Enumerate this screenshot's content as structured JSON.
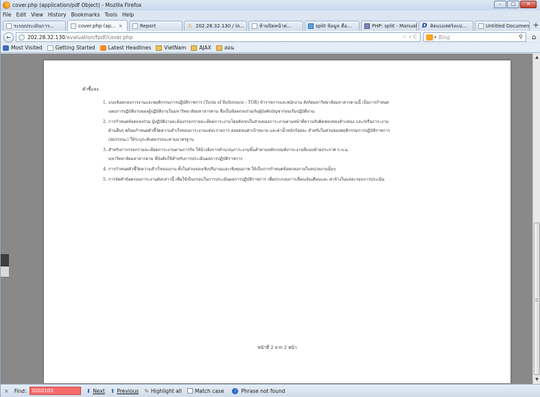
{
  "window": {
    "title": "cover.php (application/pdf Object) - Mozilla Firefox",
    "controls": {
      "minimize": "–",
      "maximize": "□",
      "close": "✕"
    }
  },
  "menu": [
    "File",
    "Edit",
    "View",
    "History",
    "Bookmarks",
    "Tools",
    "Help"
  ],
  "tabs": [
    {
      "label": "ระบบประเมินการ...",
      "icon": "page-icon",
      "active": false
    },
    {
      "label": "cover.php (ap...",
      "icon": "pdf-icon",
      "active": true,
      "close": "×"
    },
    {
      "label": "Report",
      "icon": "page-icon",
      "active": false
    },
    {
      "label": "202.28.32.130 / lo...",
      "icon": "warning-icon",
      "active": false
    },
    {
      "label": "ห้ามปิดหน้าต่...",
      "icon": "page-icon",
      "active": false
    },
    {
      "label": "split ข้อมูล คือ...",
      "icon": "twitter-icon",
      "active": false
    },
    {
      "label": "PHP: split - Manual",
      "icon": "php-icon",
      "active": false
    },
    {
      "label": "ดิดแบ่งสตริงแป...",
      "icon": "d-icon",
      "active": false
    },
    {
      "label": "Untitled Document",
      "icon": "page-icon",
      "active": false
    }
  ],
  "new_tab": "+",
  "nav": {
    "back": "←",
    "url_host": "202.28.32.130",
    "url_path": "/evaluation/fpdf/cover.php",
    "url_right": "☆ ▿ C",
    "search_placeholder": "Bing",
    "search_icon": "⚲",
    "home": "⌂"
  },
  "bookmarks": [
    {
      "label": "Most Visited",
      "icon": "firefox-icon"
    },
    {
      "label": "Getting Started",
      "icon": "page-icon"
    },
    {
      "label": "Latest Headlines",
      "icon": "rss-icon"
    },
    {
      "label": "VietNam",
      "icon": "folder-icon"
    },
    {
      "label": "AJAX",
      "icon": "folder-icon"
    },
    {
      "label": "สอน",
      "icon": "folder-icon"
    }
  ],
  "pdf": {
    "heading": "คำชี้แจง",
    "items": [
      {
        "num": "1.",
        "text": "แบบข้อตกลงการงานและพฤติกรรมการปฏิบัติราชการ (Term of Reference : TOR) ข้าราชการและพนักงาน สังกัดมหาวิทยาลัยมหาสารคามนี้ เป็นการกำหนด\nแผนการปฏิบัติงานของผู้ปฏิบัติงานในมหาวิทยาลัยมหาสารคาม ซึ่งเป็นข้อตกลงร่วมกันผู้บังคับบัญชาก่อนเริ่มปฏิบัติงาน"
      },
      {
        "num": "2.",
        "text": "การกำหนดข้อตกลงร่วม ผู้ปฏิบัติงานจะต้องกรอกรายละเอียดภาระงานโดยสังเขปในส่วนของภาระงานตามหน้าที่ความรับผิดชอบของตำแหน่ง และ/หรือภาระงาน\nด้านอื่นๆ พร้อมกำหนดตัวชี้วัดความสำเร็จของภาระงานแต่ละรายการ ตลอดจนค่าเป้าหมาย และค่าน้ำหนักร้อยละ สำหรับในส่วนของพฤติกรรมการปฏิบัติราชการ\n(สมรรถนะ) ให้ระบุระดับสมรรถนะตามมาตรฐาน"
      },
      {
        "num": "3.",
        "text": "สำหรับการกรอกรายละเอียดภาระงานตามภารกิจ ให้อ้างอิงการคำนวณภาระงานขั้นต่ำตามหลักเกณฑ์ภาระงานที่แนบท้ายประกาศ ก.บ.ม.\nมหาวิทยาลัยมหาสารคาม ที่บังคับใช้สำหรับการประเมินผลการปฏิบัติราชการ"
      },
      {
        "num": "4.",
        "text": "การกำหนดตัวชี้วัดความสำเร็จของงาน ทั้งในส่วนของเชิงปริมาณและเชิงคุณภาพ ให้เป็นการกำหนดข้อตกลงภายในหน่วยงานนั้นๆ"
      },
      {
        "num": "5.",
        "text": "การจัดทำข้อตกลงภาระงานดังกล่าวนี้ เพื่อใช้เป็นกรอบในการประเมินผลการปฏิบัติราชการ เพื่อประกอบการเลื่อนเงินเดือนและ ค่าจ้างในแต่ละรอบการประเมิน"
      }
    ],
    "footer": "หน้าที่ 2 จาก 2 หน้า"
  },
  "scroll": {
    "up": "▲",
    "down": "▼"
  },
  "findbar": {
    "close": "×",
    "label": "Find:",
    "value": "0202103",
    "next": "Next",
    "previous": "Previous",
    "highlight": "Highlight all",
    "match_case": "Match case",
    "status": "Phrase not found"
  }
}
